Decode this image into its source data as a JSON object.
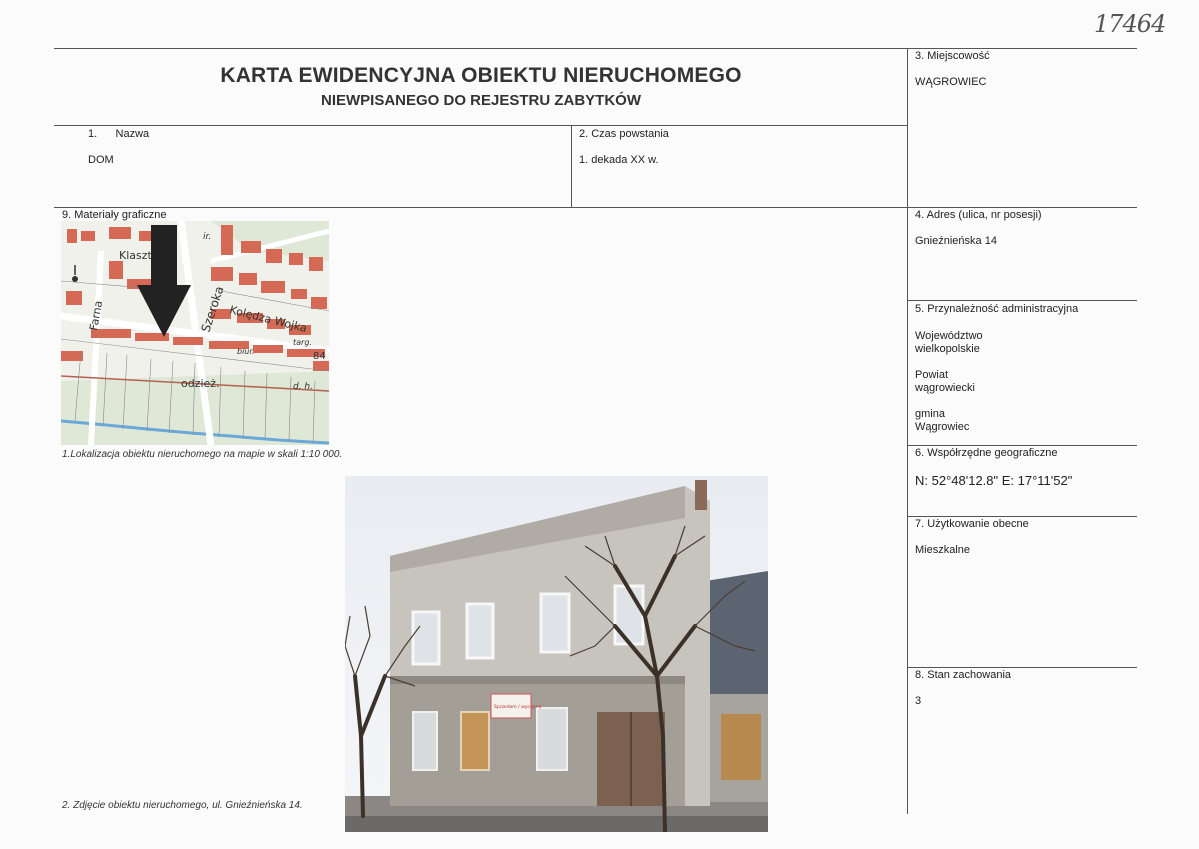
{
  "handwritten_number": "17464",
  "header": {
    "title": "KARTA EWIDENCYJNA OBIEKTU NIERUCHOMEGO",
    "subtitle": "NIEWPISANEGO DO REJESTRU ZABYTKÓW"
  },
  "fields": {
    "name_label": "1.      Nazwa",
    "name_value": "DOM",
    "created_label": "2. Czas powstania",
    "created_value": "1. dekada XX w.",
    "place_label": "3. Miejscowość",
    "place_value": "WĄGROWIEC",
    "address_label": "4. Adres (ulica, nr posesji)",
    "address_value": "Gnieźnieńska 14",
    "admin_label": "5. Przynależność administracyjna",
    "voivodeship_1": "Województwo",
    "voivodeship_2": "wielkopolskie",
    "county_1": "Powiat",
    "county_2": "wągrowiecki",
    "commune_1": "gmina",
    "commune_2": "Wągrowiec",
    "geo_label": "6. Współrzędne geograficzne",
    "geo_value": "N: 52°48'12.8\"  E: 17°11'52\"",
    "usage_label": "7. Użytkowanie obecne",
    "usage_value": "Mieszkalne",
    "condition_label": "8. Stan zachowania",
    "condition_value": "3",
    "graphics_label": "9. Materiały graficzne"
  },
  "map": {
    "street_labels": [
      "Klaszto",
      "Farna",
      "Szeroka",
      "Kolędza Wojka",
      "biur.",
      "targ.",
      "odzież.",
      "d. h.",
      "84",
      "ir."
    ],
    "caption": "1.Lokalizacja obiektu nieruchomego na mapie w skali 1:10 000."
  },
  "photo": {
    "sign_text": "Sprzedam / wynajmę",
    "caption": "2. Zdjęcie obiektu nieruchomego, ul. Gnieźnieńska 14."
  }
}
